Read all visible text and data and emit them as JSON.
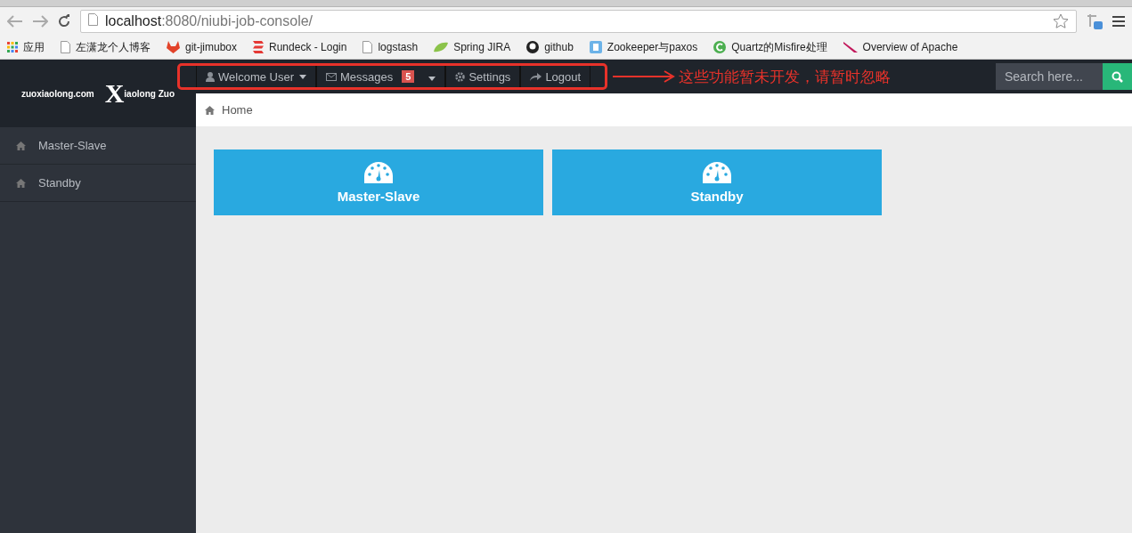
{
  "browser": {
    "url_host": "localhost",
    "url_path": ":8080/niubi-job-console/",
    "bookmarks": [
      {
        "label": "应用",
        "kind": "apps"
      },
      {
        "label": "左潇龙个人博客",
        "kind": "page"
      },
      {
        "label": "git-jimubox",
        "kind": "fox"
      },
      {
        "label": "Rundeck - Login",
        "kind": "rundeck"
      },
      {
        "label": "logstash",
        "kind": "page"
      },
      {
        "label": "Spring JIRA",
        "kind": "leaf"
      },
      {
        "label": "github",
        "kind": "github"
      },
      {
        "label": "Zookeeper与paxos",
        "kind": "blog"
      },
      {
        "label": "Quartz的Misfire处理",
        "kind": "c"
      },
      {
        "label": "Overview of Apache",
        "kind": "feather"
      }
    ]
  },
  "brand": {
    "site": "zuoxiaolong.com",
    "logo_letter": "X",
    "logo_text": "iaolong Zuo"
  },
  "navbar": {
    "items": [
      {
        "label": "Welcome User",
        "kind": "user"
      },
      {
        "label": "Messages",
        "kind": "messages",
        "badge": "5"
      },
      {
        "label": "Settings",
        "kind": "settings"
      },
      {
        "label": "Logout",
        "kind": "logout"
      }
    ],
    "annotation": "这些功能暂未开发，请暂时忽略",
    "search": {
      "placeholder": "Search here..."
    }
  },
  "sidebar": {
    "items": [
      {
        "label": "Master-Slave",
        "selected": false
      },
      {
        "label": "Standby",
        "selected": false
      }
    ]
  },
  "breadcrumb": "Home",
  "tiles": [
    {
      "label": "Master-Slave"
    },
    {
      "label": "Standby"
    }
  ]
}
